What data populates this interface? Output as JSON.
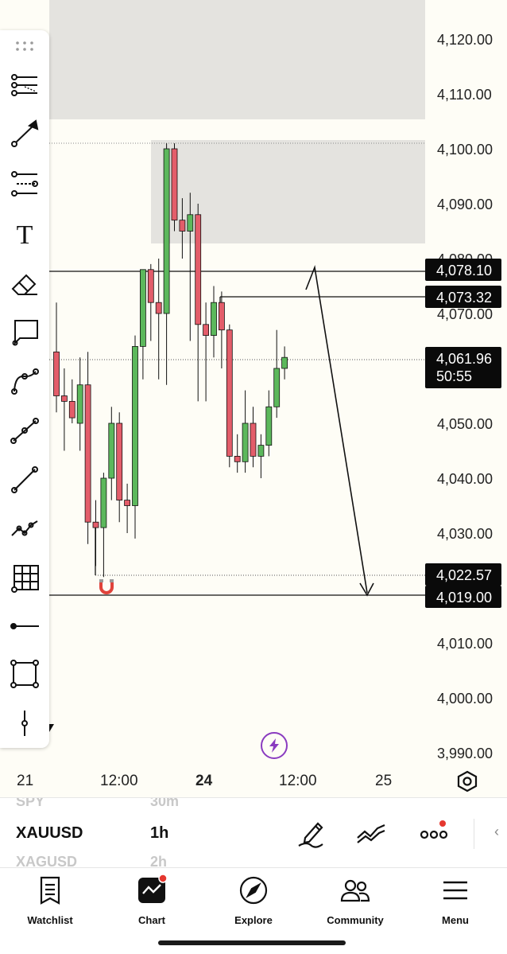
{
  "chart": {
    "price_axis": [
      "4,120.00",
      "4,110.00",
      "4,100.00",
      "4,090.00",
      "4,080.00",
      "4,070.00",
      "4,050.00",
      "4,040.00",
      "4,030.00",
      "4,010.00",
      "4,000.00",
      "3,990.00"
    ],
    "time_axis": [
      "21",
      "12:00",
      "24",
      "12:00",
      "25"
    ],
    "price_tags": [
      {
        "label": "4,078.10",
        "price": 4078.1
      },
      {
        "label": "4,073.32",
        "price": 4073.32
      },
      {
        "label": "4,022.57",
        "price": 4022.57
      },
      {
        "label": "4,019.00",
        "price": 4019.0
      }
    ],
    "current_price": {
      "label": "4,061.96",
      "countdown": "50:55",
      "price": 4061.96
    },
    "candles": [
      {
        "o": 4063,
        "h": 4072,
        "l": 4052,
        "c": 4055,
        "up": false
      },
      {
        "o": 4055,
        "h": 4060,
        "l": 4045,
        "c": 4054,
        "up": false
      },
      {
        "o": 4054,
        "h": 4058,
        "l": 4050,
        "c": 4051,
        "up": false
      },
      {
        "o": 4050,
        "h": 4062,
        "l": 4045,
        "c": 4057,
        "up": true
      },
      {
        "o": 4057,
        "h": 4063,
        "l": 4028,
        "c": 4032,
        "up": false
      },
      {
        "o": 4032,
        "h": 4036,
        "l": 4024,
        "c": 4031,
        "up": false
      },
      {
        "o": 4031,
        "h": 4041,
        "l": 4022,
        "c": 4040,
        "up": true
      },
      {
        "o": 4040,
        "h": 4053,
        "l": 4036,
        "c": 4050,
        "up": true
      },
      {
        "o": 4050,
        "h": 4052,
        "l": 4032,
        "c": 4036,
        "up": false
      },
      {
        "o": 4036,
        "h": 4039,
        "l": 4030,
        "c": 4035,
        "up": false
      },
      {
        "o": 4035,
        "h": 4066,
        "l": 4029,
        "c": 4064,
        "up": true
      },
      {
        "o": 4064,
        "h": 4075,
        "l": 4058,
        "c": 4078,
        "up": true
      },
      {
        "o": 4078,
        "h": 4079,
        "l": 4065,
        "c": 4072,
        "up": false
      },
      {
        "o": 4072,
        "h": 4080,
        "l": 4058,
        "c": 4070,
        "up": false
      },
      {
        "o": 4070,
        "h": 4101,
        "l": 4057,
        "c": 4100,
        "up": true
      },
      {
        "o": 4100,
        "h": 4101,
        "l": 4085,
        "c": 4087,
        "up": false
      },
      {
        "o": 4087,
        "h": 4091,
        "l": 4080,
        "c": 4085,
        "up": false
      },
      {
        "o": 4085,
        "h": 4092,
        "l": 4065,
        "c": 4088,
        "up": true
      },
      {
        "o": 4088,
        "h": 4090,
        "l": 4054,
        "c": 4068,
        "up": false
      },
      {
        "o": 4068,
        "h": 4072,
        "l": 4054,
        "c": 4066,
        "up": false
      },
      {
        "o": 4066,
        "h": 4075,
        "l": 4062,
        "c": 4072,
        "up": true
      },
      {
        "o": 4072,
        "h": 4074,
        "l": 4060,
        "c": 4067,
        "up": false
      },
      {
        "o": 4067,
        "h": 4068,
        "l": 4042,
        "c": 4044,
        "up": false
      },
      {
        "o": 4044,
        "h": 4048,
        "l": 4041,
        "c": 4043,
        "up": false
      },
      {
        "o": 4043,
        "h": 4056,
        "l": 4041,
        "c": 4050,
        "up": true
      },
      {
        "o": 4044,
        "h": 4053,
        "l": 4042,
        "c": 4050,
        "up": false
      },
      {
        "o": 4044,
        "h": 4048,
        "l": 4040,
        "c": 4046,
        "up": true
      },
      {
        "o": 4046,
        "h": 4056,
        "l": 4044,
        "c": 4053,
        "up": true
      },
      {
        "o": 4053,
        "h": 4067,
        "l": 4051,
        "c": 4060,
        "up": true
      },
      {
        "o": 4060,
        "h": 4064,
        "l": 4058,
        "c": 4062,
        "up": true
      }
    ],
    "colors": {
      "up": "#5cb85c",
      "down": "#e35d6a",
      "tag_bg": "#0a0a0a",
      "zone": "#e4e3df",
      "bolt": "#8a3bc0"
    }
  },
  "toolbar": {
    "tools": [
      "grip-icon",
      "horizontal-lines-icon",
      "trend-arrow-icon",
      "fib-retracement-icon",
      "text-tool-icon",
      "eraser-icon",
      "callout-icon",
      "curve-icon",
      "path-icon",
      "line-icon",
      "polyline-icon",
      "grid-icon",
      "horizontal-ray-icon",
      "rectangle-icon",
      "vertical-line-icon"
    ],
    "text_tool": "T"
  },
  "symbol_bar": {
    "prev_symbol": "SPY",
    "prev_interval": "30m",
    "symbol": "XAUUSD",
    "interval": "1h",
    "next_symbol": "XAGUSD",
    "next_interval": "2h"
  },
  "nav": {
    "items": [
      {
        "label": "Watchlist",
        "icon": "watchlist-icon"
      },
      {
        "label": "Chart",
        "icon": "chart-icon"
      },
      {
        "label": "Explore",
        "icon": "compass-icon"
      },
      {
        "label": "Community",
        "icon": "community-icon"
      },
      {
        "label": "Menu",
        "icon": "menu-icon"
      }
    ]
  }
}
